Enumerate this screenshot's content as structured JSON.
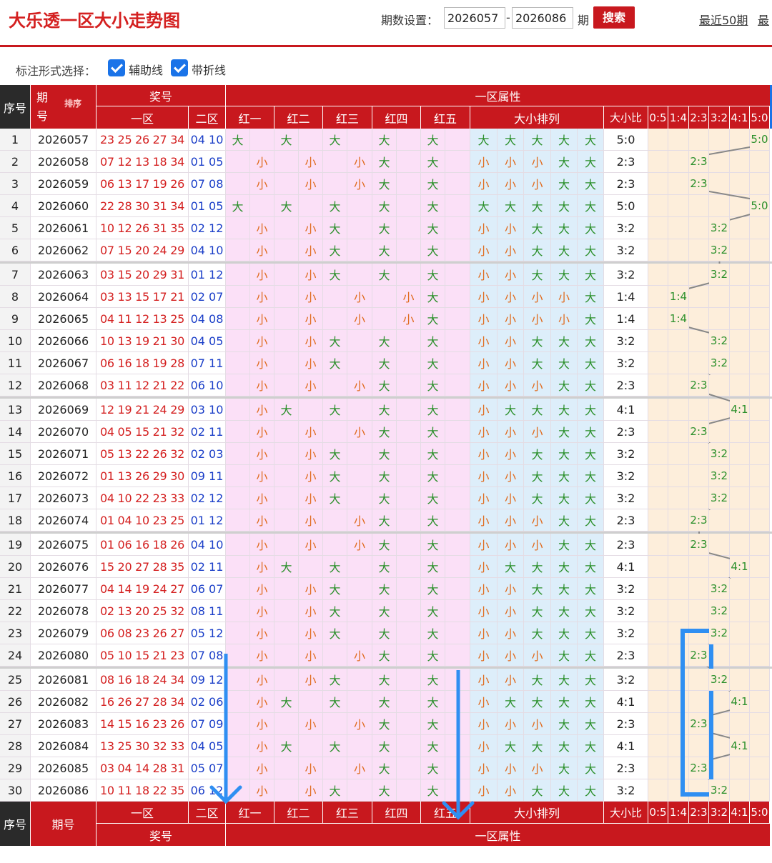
{
  "header": {
    "title": "大乐透一区大小走势图",
    "period_label": "期数设置：",
    "from": "2026057",
    "dash": "-",
    "to": "2026086",
    "qi": "期",
    "search": "搜索",
    "recent": "最近50期",
    "recent2": "最"
  },
  "mark": {
    "label": "标注形式选择：",
    "opt1": "辅助线",
    "opt2": "带折线"
  },
  "table": {
    "head": {
      "seq": "序号",
      "period": "期号",
      "sort": "排序",
      "awards": "奖号",
      "zone1": "一区",
      "zone2": "二区",
      "attr": "一区属性",
      "red": [
        "红一",
        "红二",
        "红三",
        "红四",
        "红五"
      ],
      "arr": "大小排列",
      "ratio": "大小比",
      "ratios": [
        "0:5",
        "1:4",
        "2:3",
        "3:2",
        "4:1",
        "5:0"
      ]
    },
    "rows": [
      {
        "seq": "1",
        "period": "2026057",
        "red": "23 25 26 27 34",
        "blue": "04 10",
        "sz": "大大大大大",
        "ratio": "5:0"
      },
      {
        "seq": "2",
        "period": "2026058",
        "red": "07 12 13 18 34",
        "blue": "01 05",
        "sz": "小小小大大",
        "ratio": "2:3"
      },
      {
        "seq": "3",
        "period": "2026059",
        "red": "06 13 17 19 26",
        "blue": "07 08",
        "sz": "小小小大大",
        "ratio": "2:3"
      },
      {
        "seq": "4",
        "period": "2026060",
        "red": "22 28 30 31 34",
        "blue": "01 05",
        "sz": "大大大大大",
        "ratio": "5:0"
      },
      {
        "seq": "5",
        "period": "2026061",
        "red": "10 12 26 31 35",
        "blue": "02 12",
        "sz": "小小大大大",
        "ratio": "3:2"
      },
      {
        "seq": "6",
        "period": "2026062",
        "red": "07 15 20 24 29",
        "blue": "04 10",
        "sz": "小小大大大",
        "ratio": "3:2"
      },
      {
        "seq": "7",
        "period": "2026063",
        "red": "03 15 20 29 31",
        "blue": "01 12",
        "sz": "小小大大大",
        "ratio": "3:2"
      },
      {
        "seq": "8",
        "period": "2026064",
        "red": "03 13 15 17 21",
        "blue": "02 07",
        "sz": "小小小小大",
        "ratio": "1:4"
      },
      {
        "seq": "9",
        "period": "2026065",
        "red": "04 11 12 13 25",
        "blue": "04 08",
        "sz": "小小小小大",
        "ratio": "1:4"
      },
      {
        "seq": "10",
        "period": "2026066",
        "red": "10 13 19 21 30",
        "blue": "04 05",
        "sz": "小小大大大",
        "ratio": "3:2"
      },
      {
        "seq": "11",
        "period": "2026067",
        "red": "06 16 18 19 28",
        "blue": "07 11",
        "sz": "小小大大大",
        "ratio": "3:2"
      },
      {
        "seq": "12",
        "period": "2026068",
        "red": "03 11 12 21 22",
        "blue": "06 10",
        "sz": "小小小大大",
        "ratio": "2:3"
      },
      {
        "seq": "13",
        "period": "2026069",
        "red": "12 19 21 24 29",
        "blue": "03 10",
        "sz": "小大大大大",
        "ratio": "4:1"
      },
      {
        "seq": "14",
        "period": "2026070",
        "red": "04 05 15 21 32",
        "blue": "02 11",
        "sz": "小小小大大",
        "ratio": "2:3"
      },
      {
        "seq": "15",
        "period": "2026071",
        "red": "05 13 22 26 32",
        "blue": "02 03",
        "sz": "小小大大大",
        "ratio": "3:2"
      },
      {
        "seq": "16",
        "period": "2026072",
        "red": "01 13 26 29 30",
        "blue": "09 11",
        "sz": "小小大大大",
        "ratio": "3:2"
      },
      {
        "seq": "17",
        "period": "2026073",
        "red": "04 10 22 23 33",
        "blue": "02 12",
        "sz": "小小大大大",
        "ratio": "3:2"
      },
      {
        "seq": "18",
        "period": "2026074",
        "red": "01 04 10 23 25",
        "blue": "01 12",
        "sz": "小小小大大",
        "ratio": "2:3"
      },
      {
        "seq": "19",
        "period": "2026075",
        "red": "01 06 16 18 26",
        "blue": "04 10",
        "sz": "小小小大大",
        "ratio": "2:3"
      },
      {
        "seq": "20",
        "period": "2026076",
        "red": "15 20 27 28 35",
        "blue": "02 11",
        "sz": "小大大大大",
        "ratio": "4:1"
      },
      {
        "seq": "21",
        "period": "2026077",
        "red": "04 14 19 24 27",
        "blue": "06 07",
        "sz": "小小大大大",
        "ratio": "3:2"
      },
      {
        "seq": "22",
        "period": "2026078",
        "red": "02 13 20 25 32",
        "blue": "08 11",
        "sz": "小小大大大",
        "ratio": "3:2"
      },
      {
        "seq": "23",
        "period": "2026079",
        "red": "06 08 23 26 27",
        "blue": "05 12",
        "sz": "小小大大大",
        "ratio": "3:2"
      },
      {
        "seq": "24",
        "period": "2026080",
        "red": "05 10 15 21 23",
        "blue": "07 08",
        "sz": "小小小大大",
        "ratio": "2:3"
      },
      {
        "seq": "25",
        "period": "2026081",
        "red": "08 16 18 24 34",
        "blue": "09 12",
        "sz": "小小大大大",
        "ratio": "3:2"
      },
      {
        "seq": "26",
        "period": "2026082",
        "red": "16 26 27 28 34",
        "blue": "02 06",
        "sz": "小大大大大",
        "ratio": "4:1"
      },
      {
        "seq": "27",
        "period": "2026083",
        "red": "14 15 16 23 26",
        "blue": "07 09",
        "sz": "小小小大大",
        "ratio": "2:3"
      },
      {
        "seq": "28",
        "period": "2026084",
        "red": "13 25 30 32 33",
        "blue": "04 05",
        "sz": "小大大大大",
        "ratio": "4:1"
      },
      {
        "seq": "29",
        "period": "2026085",
        "red": "03 04 14 28 31",
        "blue": "05 07",
        "sz": "小小小大大",
        "ratio": "2:3"
      },
      {
        "seq": "30",
        "period": "2026086",
        "red": "10 11 18 22 35",
        "blue": "06 12",
        "sz": "小小大大大",
        "ratio": "3:2"
      }
    ]
  },
  "colors": {
    "red": "#c8181e",
    "pink": "#fbe0f7",
    "blue_bg": "#ddeefa",
    "cream": "#fdeedb",
    "da": "#2a8f2a",
    "xiao": "#e06b1e",
    "num_red": "#d42020",
    "num_blue": "#1a3ec8",
    "annotation": "#2f8ff2"
  }
}
